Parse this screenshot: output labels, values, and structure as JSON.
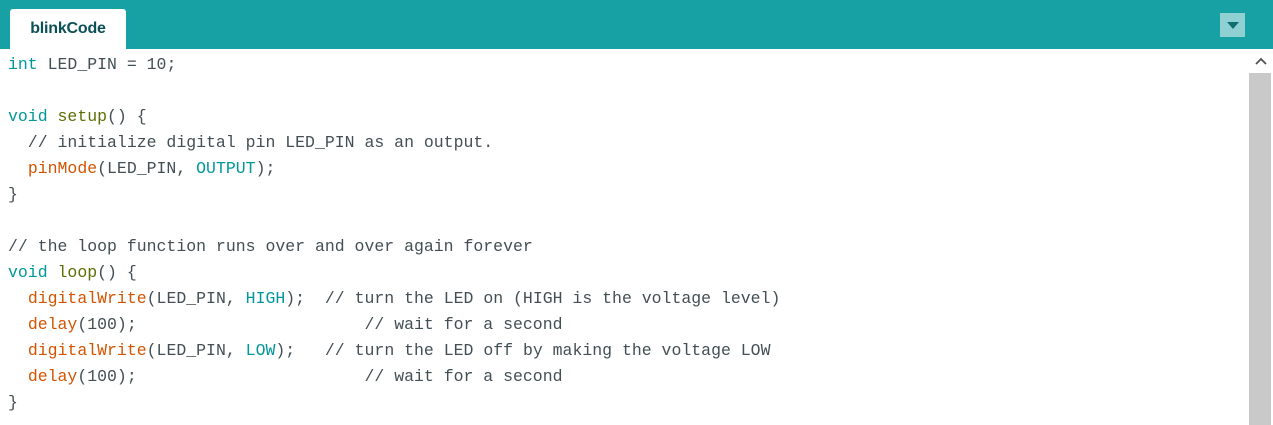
{
  "tabs": [
    {
      "label": "blinkCode",
      "active": true
    }
  ],
  "tab_menu_icon": "triangle-down-icon",
  "colors": {
    "tab_bar": "#17a1a5",
    "keyword": "#00979c",
    "function_name": "#5e6d03",
    "builtin": "#d35400",
    "text": "#434f54",
    "scrollbar_thumb": "#c9c9c9"
  },
  "code": {
    "lines": [
      [
        {
          "t": "kw",
          "v": "int"
        },
        {
          "t": "tx",
          "v": " LED_PIN = 10;"
        }
      ],
      [],
      [
        {
          "t": "kw",
          "v": "void"
        },
        {
          "t": "tx",
          "v": " "
        },
        {
          "t": "fn",
          "v": "setup"
        },
        {
          "t": "tx",
          "v": "() {"
        }
      ],
      [
        {
          "t": "cm",
          "v": "  // initialize digital pin LED_PIN as an output."
        }
      ],
      [
        {
          "t": "tx",
          "v": "  "
        },
        {
          "t": "bi",
          "v": "pinMode"
        },
        {
          "t": "tx",
          "v": "(LED_PIN, "
        },
        {
          "t": "kw",
          "v": "OUTPUT"
        },
        {
          "t": "tx",
          "v": ");"
        }
      ],
      [
        {
          "t": "tx",
          "v": "}"
        }
      ],
      [],
      [
        {
          "t": "cm",
          "v": "// the loop function runs over and over again forever"
        }
      ],
      [
        {
          "t": "kw",
          "v": "void"
        },
        {
          "t": "tx",
          "v": " "
        },
        {
          "t": "fn",
          "v": "loop"
        },
        {
          "t": "tx",
          "v": "() {"
        }
      ],
      [
        {
          "t": "tx",
          "v": "  "
        },
        {
          "t": "bi",
          "v": "digitalWrite"
        },
        {
          "t": "tx",
          "v": "(LED_PIN, "
        },
        {
          "t": "kw",
          "v": "HIGH"
        },
        {
          "t": "tx",
          "v": ");  "
        },
        {
          "t": "cm",
          "v": "// turn the LED on (HIGH is the voltage level)"
        }
      ],
      [
        {
          "t": "tx",
          "v": "  "
        },
        {
          "t": "bi",
          "v": "delay"
        },
        {
          "t": "tx",
          "v": "(100);                       "
        },
        {
          "t": "cm",
          "v": "// wait for a second"
        }
      ],
      [
        {
          "t": "tx",
          "v": "  "
        },
        {
          "t": "bi",
          "v": "digitalWrite"
        },
        {
          "t": "tx",
          "v": "(LED_PIN, "
        },
        {
          "t": "kw",
          "v": "LOW"
        },
        {
          "t": "tx",
          "v": ");   "
        },
        {
          "t": "cm",
          "v": "// turn the LED off by making the voltage LOW"
        }
      ],
      [
        {
          "t": "tx",
          "v": "  "
        },
        {
          "t": "bi",
          "v": "delay"
        },
        {
          "t": "tx",
          "v": "(100);                       "
        },
        {
          "t": "cm",
          "v": "// wait for a second"
        }
      ],
      [
        {
          "t": "tx",
          "v": "}"
        }
      ]
    ]
  },
  "scrollbar": {
    "up_icon": "chevron-up-icon"
  }
}
